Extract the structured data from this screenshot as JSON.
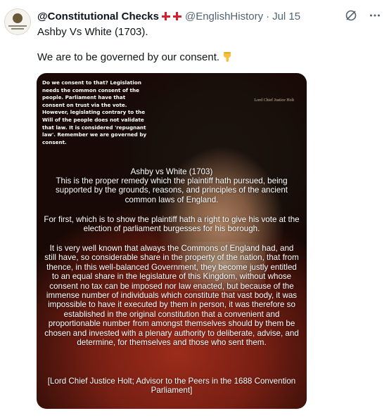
{
  "tweet": {
    "display_name": "@Constitutional Checks",
    "flag_icon": "england-flag-icon",
    "handle": "@EnglishHistory",
    "separator": "·",
    "date": "Jul 15",
    "line1": "Ashby Vs White (1703).",
    "line2": "We are to be governed by our consent.",
    "emoji": "backhand-index-pointing-down-emoji"
  },
  "top_icons": [
    "grok-icon",
    "more-icon"
  ],
  "media": {
    "signature": "Lord Chief Justice Holt",
    "overlay_note": "Do we consent to that? Legislation needs the common consent of the people. Parliament have that consent on trust via the vote. However, legislating contrary to the Will of the people does not validate that law. It is considered 'repugnant law'. Remember we are governed by consent.",
    "quote_title": "Ashby vs White (1703)",
    "quote_p1": "This is the proper remedy which the plaintiff hath pursued, being supported by the grounds, reasons, and principles of the ancient common laws of England.",
    "quote_p2": "For first, which is to show the plaintiff hath a right to give his vote at the election of parliament burgesses for his borough.",
    "quote_p3": "It is very well known that always the Commons of England had, and still have, so considerable share in the property of the nation, that from thence, in this well-balanced Government, they become justly entitled to an equal share in the legislature of this Kingdom, without whose consent no tax can be imposed nor law enacted, but because of the immense number of individuals which constitute that vast body, it was impossible to have it executed by them in person, it was therefore so established in the original constitution that a convenient and proportionable number from amongst themselves should by them be chosen and invested with a plenary authority to deliberate, advise, and determine, for themselves and those who sent them.",
    "quote_attr": "[Lord Chief Justice Holt; Advisor to the Peers in the 1688 Convention Parliament]"
  },
  "colors": {
    "text_primary": "#0f1419",
    "text_secondary": "#536471",
    "flag_red": "#d61f2c"
  }
}
